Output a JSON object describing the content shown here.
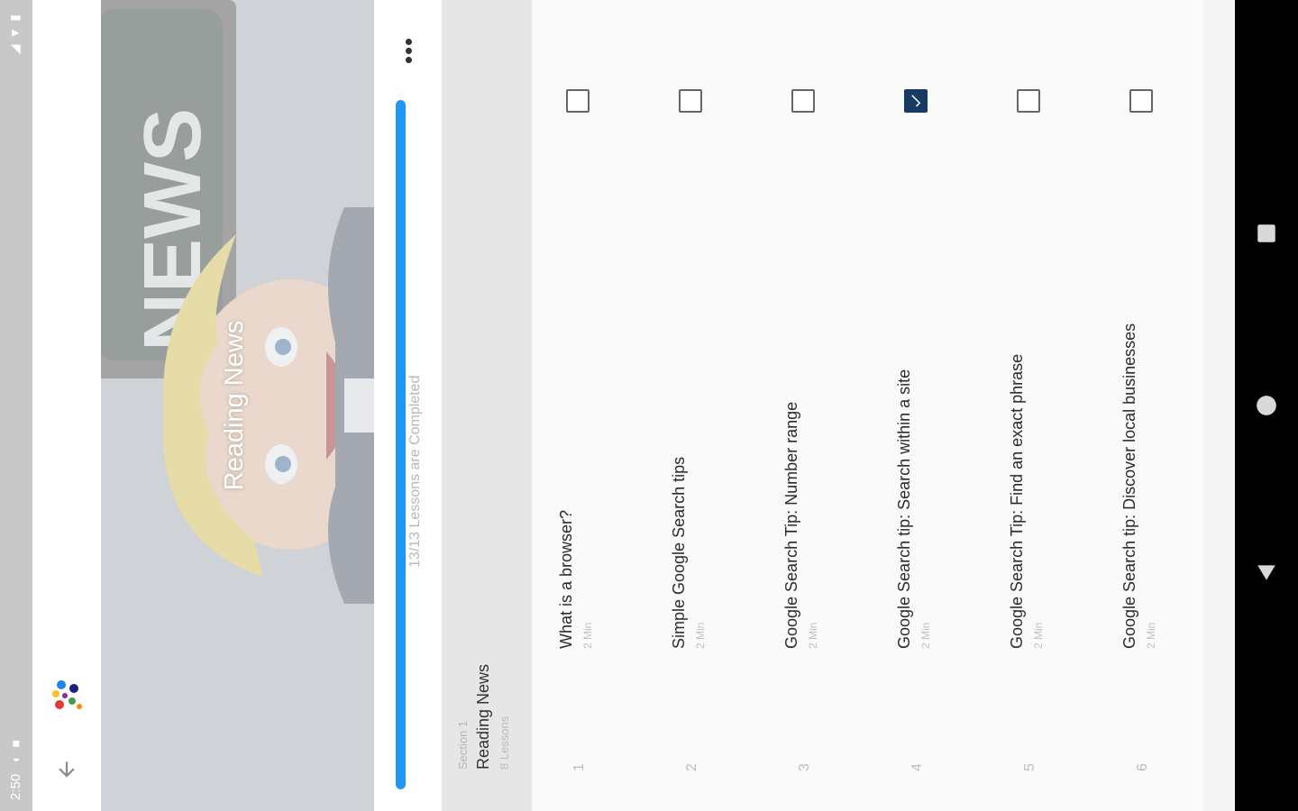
{
  "status_bar": {
    "time": "2:50",
    "left_icons": [
      "sd-card-icon",
      "sync-icon",
      "sim-icon"
    ],
    "right_icons": [
      "wifi-icon",
      "signal-icon",
      "battery-icon"
    ]
  },
  "app_bar": {
    "back_icon": "arrow-back-icon",
    "logo": "app-logo"
  },
  "hero": {
    "title": "Reading News",
    "image_icon": "news-cartoon-illustration"
  },
  "progress": {
    "completed": 13,
    "total": 13,
    "fraction": 1.0,
    "text": "13/13 Lessons are Completed",
    "more_icon": "more-horizontal-icon"
  },
  "section": {
    "label": "Section 1",
    "title": "Reading News",
    "lessons_count": "8 Lessons"
  },
  "lessons": [
    {
      "number": "1",
      "title": "What is a browser?",
      "duration": "2 Min",
      "checked": false
    },
    {
      "number": "2",
      "title": "Simple Google Search tips",
      "duration": "2 Min",
      "checked": false
    },
    {
      "number": "3",
      "title": "Google Search Tip: Number range",
      "duration": "2 Min",
      "checked": false
    },
    {
      "number": "4",
      "title": "Google Search tip: Search within a site",
      "duration": "2 Min",
      "checked": true
    },
    {
      "number": "5",
      "title": "Google Search Tip: Find an exact phrase",
      "duration": "2 Min",
      "checked": false
    },
    {
      "number": "6",
      "title": "Google Search tip: Discover local businesses",
      "duration": "2 Min",
      "checked": false
    }
  ],
  "nav_bar": {
    "icons": [
      "back-triangle-icon",
      "home-circle-icon",
      "recents-square-icon"
    ]
  },
  "colors": {
    "progress_fill": "#2196f3",
    "checked_box": "#1a3a66",
    "nav_bar": "#000000"
  }
}
